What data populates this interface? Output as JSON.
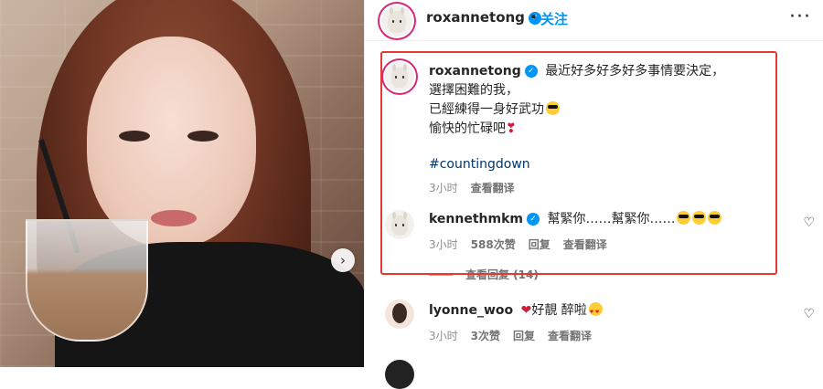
{
  "post": {
    "author": "roxannetong",
    "follow_label": "关注",
    "separator": "•",
    "more_label": "···",
    "next_arrow": "›"
  },
  "caption": {
    "user": "roxannetong",
    "line1": "最近好多好多好多事情要決定，",
    "line2": "選擇困難的我，",
    "line3": "已經練得一身好武功",
    "line4": "愉快的忙碌吧",
    "hashtag": "#countingdown",
    "time": "3小时",
    "translate": "查看翻译",
    "emoji_line3": "smiling-face-sunglasses",
    "emoji_line4": "red-heart-exclamation"
  },
  "comments": [
    {
      "user": "kennethmkm",
      "verified": true,
      "text": "幫緊你……幫緊你……",
      "emojis": [
        "smiling-face-sunglasses",
        "smiling-face-sunglasses",
        "smiling-face-sunglasses"
      ],
      "time": "3小时",
      "likes": "588次赞",
      "reply": "回复",
      "translate": "查看翻译",
      "view_replies": "查看回复 (14)"
    },
    {
      "user": "lyonne_woo",
      "verified": false,
      "text": "好靚 醉啦",
      "emojis": [
        "red-heart",
        "heart-eyes-face"
      ],
      "time": "3小时",
      "likes": "3次赞",
      "reply": "回复",
      "translate": "查看翻译"
    }
  ],
  "colors": {
    "accent": "#0095f6",
    "highlight_border": "#e53935",
    "hashtag": "#00376b",
    "meta": "#8e8e8e"
  }
}
